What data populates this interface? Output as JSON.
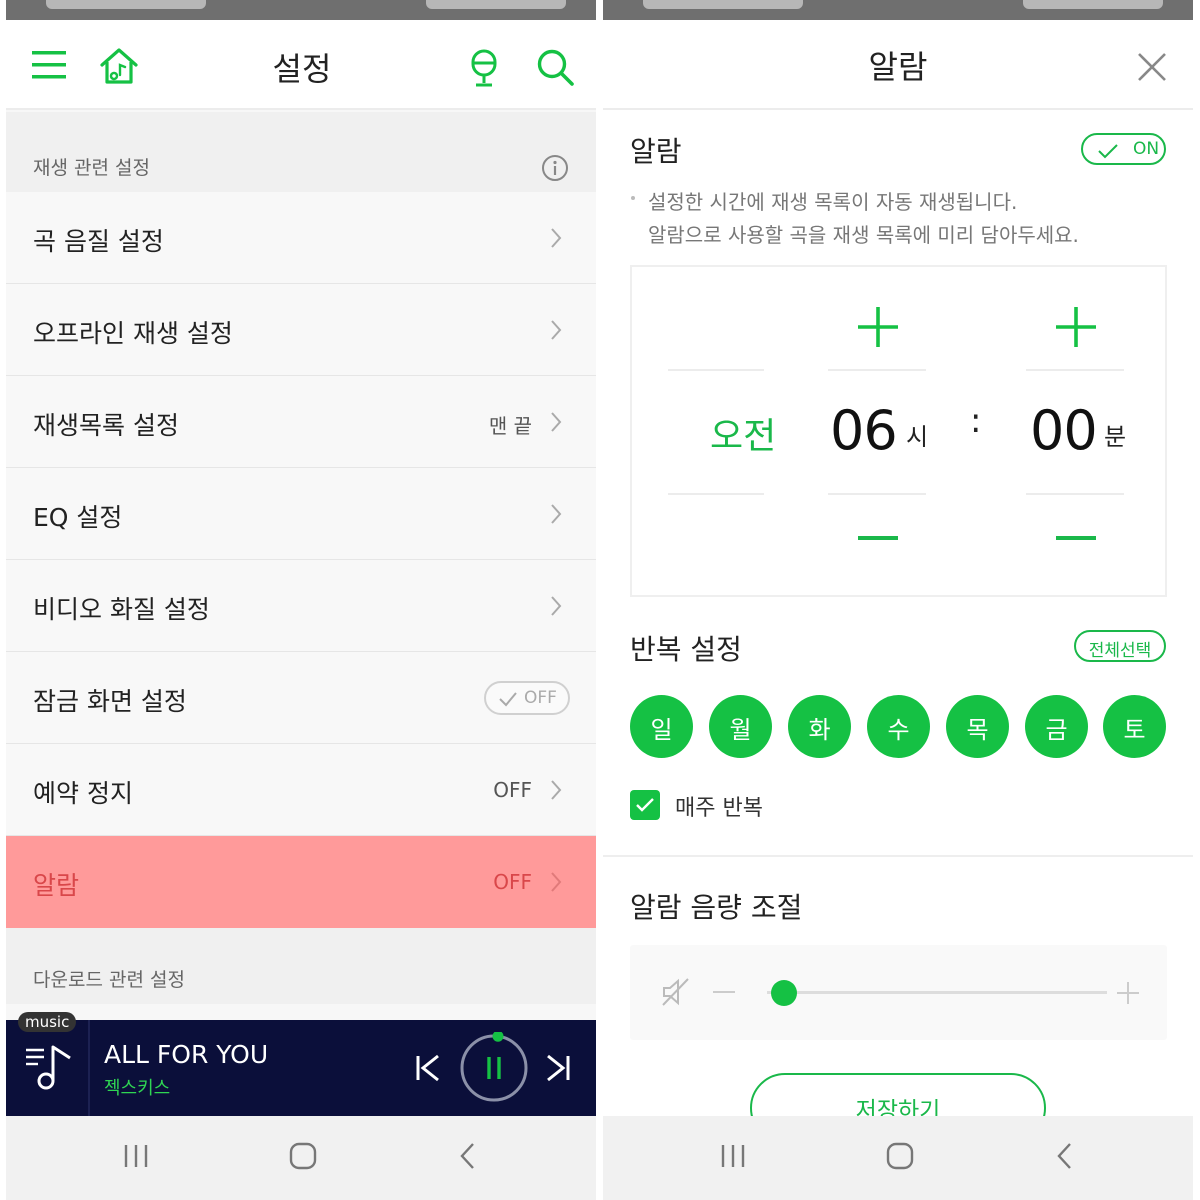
{
  "left": {
    "title": "설정",
    "sections": {
      "playback": "재생 관련 설정",
      "download": "다운로드 관련 설정"
    },
    "rows": [
      {
        "label": "곡 음질 설정",
        "value": ""
      },
      {
        "label": "오프라인 재생 설정",
        "value": ""
      },
      {
        "label": "재생목록 설정",
        "value": "맨 끝"
      },
      {
        "label": "EQ 설정",
        "value": ""
      },
      {
        "label": "비디오 화질 설정",
        "value": ""
      },
      {
        "label": "잠금 화면 설정",
        "value": "OFF"
      },
      {
        "label": "예약 정지",
        "value": "OFF"
      },
      {
        "label": "알람",
        "value": "OFF"
      }
    ],
    "player": {
      "tag": "music",
      "title": "ALL FOR YOU",
      "artist": "젝스키스",
      "progress": 0.02
    }
  },
  "right": {
    "title": "알람",
    "alarm": {
      "label": "알람",
      "toggle": "ON",
      "desc1": "설정한 시간에 재생 목록이 자동 재생됩니다.",
      "desc2": "알람으로 사용할 곡을 재생 목록에 미리 담아두세요."
    },
    "time": {
      "ampm": "오전",
      "hour": "06",
      "hour_unit": "시",
      "colon": ":",
      "minute": "00",
      "minute_unit": "분"
    },
    "repeat": {
      "title": "반복 설정",
      "select_all": "전체선택",
      "days": [
        "일",
        "월",
        "화",
        "수",
        "목",
        "금",
        "토"
      ],
      "weekly": "매주 반복"
    },
    "volume": {
      "title": "알람 음량 조절",
      "level": 0.05
    },
    "save": "저장하기"
  },
  "colors": {
    "accent": "#15c144",
    "highlight": "#ff9a9a",
    "player_bg": "#0b0f3a"
  }
}
